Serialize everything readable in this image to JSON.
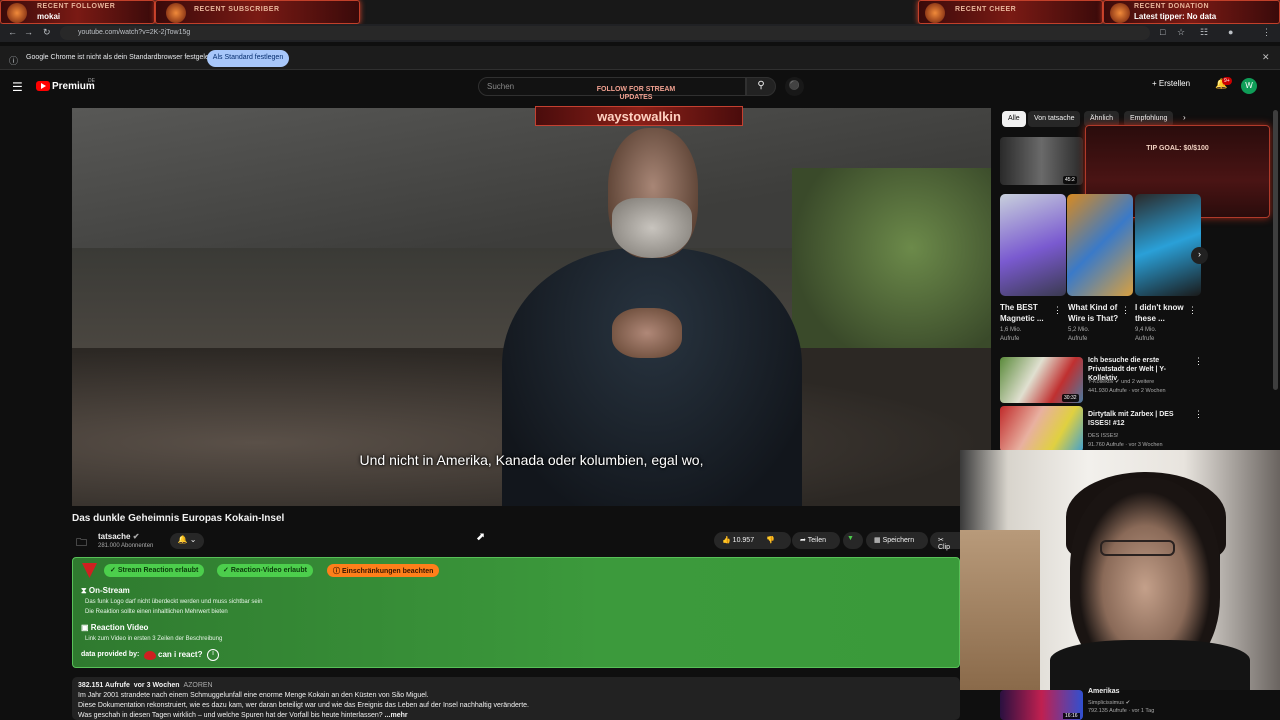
{
  "overlay": {
    "follower_title": "RECENT FOLLOWER",
    "follower_name": "mokai",
    "subscriber_title": "RECENT SUBSCRIBER",
    "cheer_title": "RECENT CHEER",
    "donation_title": "RECENT DONATION",
    "donation_value": "Latest tipper: No data",
    "follow_prompt": "FOLLOW FOR STREAM UPDATES",
    "streamer_name": "waystowalkin",
    "tip_goal": "TIP GOAL: $0/$100"
  },
  "browser": {
    "url": "youtube.com/watch?v=2K-2jTow15g",
    "infobar_text": "Google Chrome ist nicht als dein Standardbrowser festgelegt",
    "infobar_button": "Als Standard festlegen",
    "back_icon": "arrow-left-icon",
    "forward_icon": "arrow-right-icon",
    "reload_icon": "reload-icon",
    "close_icon": "close-icon"
  },
  "header": {
    "logo_text": "Premium",
    "logo_region": "DE",
    "search_placeholder": "Suchen",
    "create_label": "Erstellen",
    "notification_count": "9+",
    "avatar_letter": "W"
  },
  "video": {
    "subtitle": "Und nicht in Amerika, Kanada oder kolumbien, egal wo,",
    "title": "Das dunkle Geheimnis Europas Kokain-Insel",
    "channel_name": "tatsache",
    "channel_subs": "281.000 Abonnenten",
    "likes": "10.957",
    "share_label": "Teilen",
    "save_label": "Speichern",
    "clip_label": "Clip"
  },
  "react_panel": {
    "badge_stream": "Stream Reaction erlaubt",
    "badge_video": "Reaction-Video erlaubt",
    "badge_restrictions": "Einschränkungen beachten",
    "onstream_title": "On-Stream",
    "onstream_line1": "Das funk Logo darf nicht überdeckt werden und muss sichtbar sein",
    "onstream_line2": "Die Reaktion sollte einen inhaltlichen Mehrwert bieten",
    "reaction_title": "Reaction Video",
    "reaction_line1": "Link zum Video in ersten 3 Zeilen der Beschreibung",
    "provided_label": "data provided by:",
    "provided_name": "can i react?"
  },
  "description": {
    "views": "382.151 Aufrufe",
    "age": "vor 3 Wochen",
    "tag": "AZOREN",
    "line1": "Im Jahr 2001 strandete nach einem Schmuggelunfall eine enorme Menge Kokain an den Küsten von São Miguel.",
    "line2": "Diese Dokumentation rekonstruiert, wie es dazu kam, wer daran beteiligt war und wie das Ereignis das Leben auf der Insel nachhaltig veränderte.",
    "line3": "Was geschah in diesen Tagen wirklich – und welche Spuren hat der Vorfall bis heute hinterlassen?",
    "more": "...mehr"
  },
  "sidebar": {
    "chips": [
      "Alle",
      "Von tatsache",
      "Ähnlich",
      "Empfohlung"
    ],
    "top_duration": "45:2",
    "shorts": [
      {
        "title": "The BEST Magnetic ...",
        "views": "1,6 Mio.",
        "views2": "Aufrufe"
      },
      {
        "title": "What Kind of Wire is That?",
        "views": "5,2 Mio.",
        "views2": "Aufrufe"
      },
      {
        "title": "I didn't know these ...",
        "views": "9,4 Mio.",
        "views2": "Aufrufe"
      }
    ],
    "videos": [
      {
        "title": "Ich besuche die erste Privatstadt der Welt | Y-Kollektiv",
        "channel": "Y-Kollektiv",
        "extra": "und 2 weitere",
        "meta": "441.930 Aufrufe · vor 2 Wochen",
        "duration": "30:32"
      },
      {
        "title": "Dirtytalk mit Zarbex | DES ISSES! #12",
        "channel": "DES ISSES!",
        "extra": "",
        "meta": "91.760 Aufrufe · vor 3 Wochen",
        "duration": "1:21:10"
      }
    ],
    "bottom": {
      "title": "Amerikas",
      "channel": "Simplicissimus",
      "meta": "792.135 Aufrufe · vor 1 Tag",
      "duration": "16:16"
    }
  }
}
